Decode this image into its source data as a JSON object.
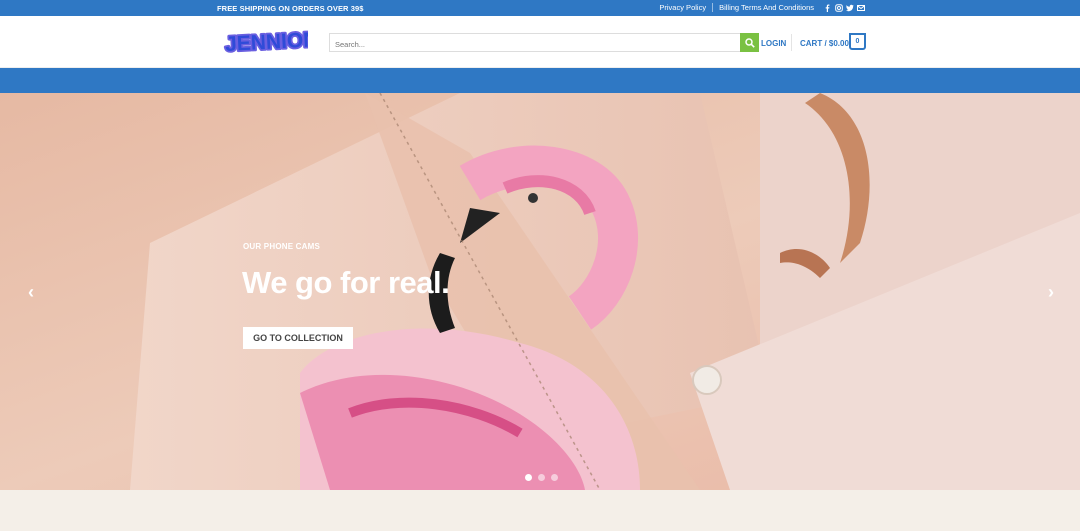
{
  "topbar": {
    "promo": "FREE SHIPPING ON ORDERS OVER 39$",
    "links": [
      "Privacy Policy",
      "Billing Terms And Conditions"
    ],
    "social_icons": [
      "facebook-icon",
      "instagram-icon",
      "twitter-icon",
      "email-icon"
    ]
  },
  "header": {
    "logo_text": "JENNION",
    "search_placeholder": "Search...",
    "login_label": "LOGIN",
    "cart_label": "CART / $0.00",
    "cart_count": "0"
  },
  "hero": {
    "eyebrow": "OUR PHONE CAMS",
    "headline": "We go for real.",
    "cta_label": "GO TO COLLECTION",
    "prev_arrow": "‹",
    "next_arrow": "›",
    "slides": 3,
    "active_slide": 1
  },
  "colors": {
    "brand_blue": "#2f78c4",
    "search_green": "#7ac142",
    "page_bg": "#f4efe8"
  }
}
